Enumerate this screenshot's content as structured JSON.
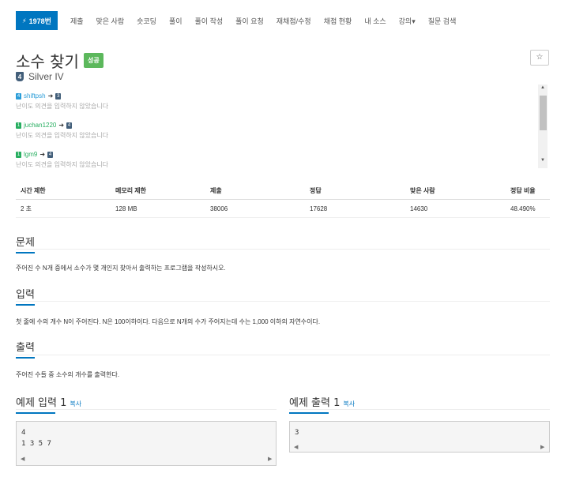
{
  "nav": {
    "active": {
      "icon": "bolt-icon",
      "label": "1978번"
    },
    "items": [
      "제출",
      "맞은 사람",
      "숏코딩",
      "풀이",
      "풀이 작성",
      "풀이 요청",
      "재채점/수정",
      "채점 현황",
      "내 소스",
      "강의▾",
      "질문 검색"
    ]
  },
  "problem": {
    "title": "소수 찾기",
    "result_badge": "성공",
    "tier_badge": "4",
    "tier": "Silver IV",
    "star": "☆"
  },
  "opinions": [
    {
      "user": "shiftpsh",
      "from_tier": "4",
      "to_tier": "3",
      "from_color": "#2a9dd8",
      "to_color": "#435f7a",
      "text": "난이도 의견을 입력하지 않았습니다"
    },
    {
      "user": "juchan1220",
      "from_tier": "1",
      "to_tier": "4",
      "from_color": "#27ae60",
      "to_color": "#435f7a",
      "text": "난이도 의견을 입력하지 않았습니다"
    },
    {
      "user": "lgm9",
      "from_tier": "1",
      "to_tier": "4",
      "from_color": "#27ae60",
      "to_color": "#435f7a",
      "text": "난이도 의견을 입력하지 않았습니다"
    }
  ],
  "stats": {
    "headers": [
      "시간 제한",
      "메모리 제한",
      "제출",
      "정답",
      "맞은 사람",
      "정답 비율"
    ],
    "values": [
      "2 초",
      "128 MB",
      "38006",
      "17628",
      "14630",
      "48.490%"
    ]
  },
  "sections": {
    "problem_h": "문제",
    "problem_p": "주어진 수 N개 중에서 소수가 몇 개인지 찾아서 출력하는 프로그램을 작성하시오.",
    "input_h": "입력",
    "input_p": "첫 줄에 수의 개수 N이 주어진다. N은 100이하이다. 다음으로 N개의 수가 주어지는데 수는 1,000 이하의 자연수이다.",
    "output_h": "출력",
    "output_p": "주어진 수들 중 소수의 개수를 출력한다."
  },
  "examples": {
    "input_h": "예제 입력 1",
    "output_h": "예제 출력 1",
    "copy": "복사",
    "input_lines": [
      "4",
      "1 3 5 7"
    ],
    "output_lines": [
      "3"
    ]
  },
  "colors": {
    "accent": "#0076c0",
    "success": "#5cb85c"
  }
}
